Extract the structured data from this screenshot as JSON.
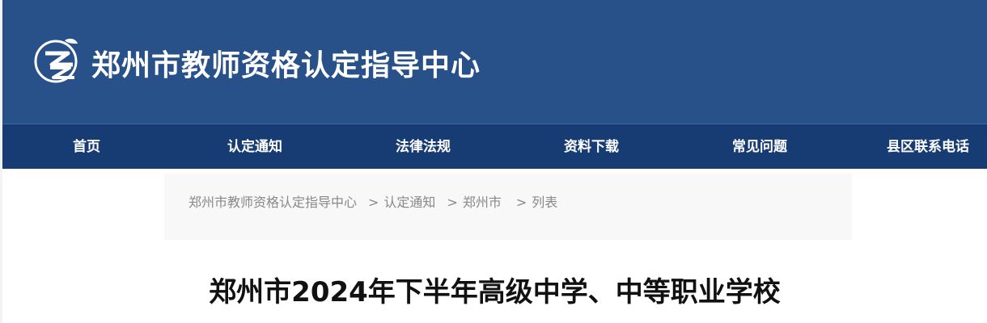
{
  "header": {
    "site_title": "郑州市教师资格认定指导中心",
    "logo_icon": "zz-logo-icon"
  },
  "nav": {
    "items": [
      {
        "label": "首页"
      },
      {
        "label": "认定通知"
      },
      {
        "label": "法律法规"
      },
      {
        "label": "资料下载"
      },
      {
        "label": "常见问题"
      },
      {
        "label": "县区联系电话"
      }
    ]
  },
  "breadcrumb": {
    "items": [
      "郑州市教师资格认定指导中心",
      "认定通知",
      "郑州市",
      "列表"
    ],
    "separator": ">"
  },
  "article": {
    "title": "郑州市2024年下半年高级中学、中等职业学校"
  },
  "colors": {
    "header_bg": "#285089",
    "nav_bg": "#173c74",
    "page_bg": "#f2f3f5"
  }
}
